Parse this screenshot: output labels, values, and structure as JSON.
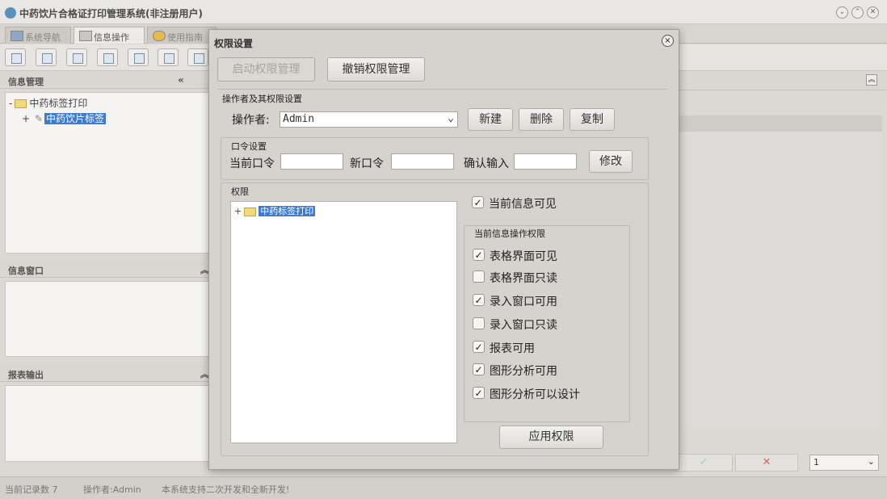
{
  "app": {
    "title": "中药饮片合格证打印管理系统(非注册用户)"
  },
  "main_tabs": [
    {
      "label": "系统导航"
    },
    {
      "label": "信息操作"
    },
    {
      "label": "使用指南"
    }
  ],
  "left": {
    "info_panel_title": "信息管理",
    "tree_root": "中药标签打印",
    "tree_child": "中药饮片标签",
    "info_window_title": "信息窗口",
    "report_title": "报表输出",
    "collapse_glyph": "«",
    "expand_glyph": "︽"
  },
  "right": {
    "confirm_glyph": "✓",
    "cancel_glyph": "✕",
    "page_value": "1"
  },
  "status": {
    "record_count": "当前记录数 7",
    "operator": "操作者:Admin",
    "message": "本系统支持二次开发和全新开发!"
  },
  "dialog": {
    "title": "权限设置",
    "close_glyph": "×",
    "enable_btn": "启动权限管理",
    "revoke_btn": "撤销权限管理",
    "operator_group": "操作者及其权限设置",
    "operator_label": "操作者:",
    "operator_value": "Admin",
    "new_btn": "新建",
    "delete_btn": "删除",
    "copy_btn": "复制",
    "password_group": "口令设置",
    "current_pwd_label": "当前口令",
    "new_pwd_label": "新口令",
    "confirm_pwd_label": "确认输入",
    "modify_btn": "修改",
    "permission_group": "权限",
    "tree_root": "中药标签打印",
    "current_visible": "当前信息可见",
    "ops_group": "当前信息操作权限",
    "options": [
      {
        "label": "表格界面可见",
        "checked": true
      },
      {
        "label": "表格界面只读",
        "checked": false
      },
      {
        "label": "录入窗口可用",
        "checked": true
      },
      {
        "label": "录入窗口只读",
        "checked": false
      },
      {
        "label": "报表可用",
        "checked": true
      },
      {
        "label": "图形分析可用",
        "checked": true
      },
      {
        "label": "图形分析可以设计",
        "checked": true
      }
    ],
    "apply_btn": "应用权限",
    "check_glyph": "✓"
  }
}
